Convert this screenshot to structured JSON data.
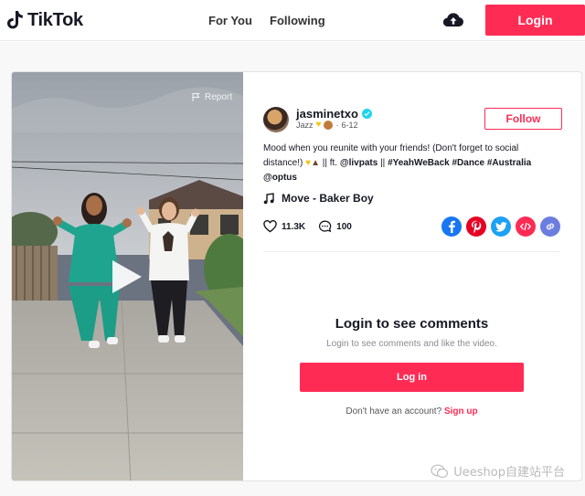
{
  "brand": {
    "name": "TikTok"
  },
  "nav": {
    "for_you": "For You",
    "following": "Following"
  },
  "header": {
    "login_label": "Login"
  },
  "video": {
    "report_label": "Report"
  },
  "author": {
    "username": "jasminetxo",
    "music_tag": "Jazz",
    "date": "6-12",
    "follow_label": "Follow"
  },
  "post": {
    "caption_prefix": "Mood when you reunite with your friends! (Don't forget to social distance!) ",
    "caption_mid": " || ft. ",
    "mention1": "@livpats",
    "sep": " || ",
    "tag1": "#YeahWeBack",
    "tag2": "#Dance",
    "tag3": "#Australia",
    "mention2": "@optus",
    "music": "Move - Baker Boy",
    "likes": "11.3K",
    "comments": "100"
  },
  "share_icons": [
    {
      "icon": "facebook-icon",
      "color": "#1877f2"
    },
    {
      "icon": "pinterest-icon",
      "color": "#e60023"
    },
    {
      "icon": "twitter-icon",
      "color": "#1da1f2"
    },
    {
      "icon": "embed-icon",
      "color": "#fe2c55"
    },
    {
      "icon": "link-icon",
      "color": "#6c7de0"
    }
  ],
  "comments_panel": {
    "title": "Login to see comments",
    "subtitle": "Login to see comments and like the video.",
    "login_label": "Log in",
    "no_account": "Don't have an account?",
    "signup_label": "Sign up"
  },
  "watermark": {
    "text": "Ueeshop自建站平台"
  },
  "colors": {
    "accent": "#fe2c55",
    "verified": "#20d5ec"
  }
}
